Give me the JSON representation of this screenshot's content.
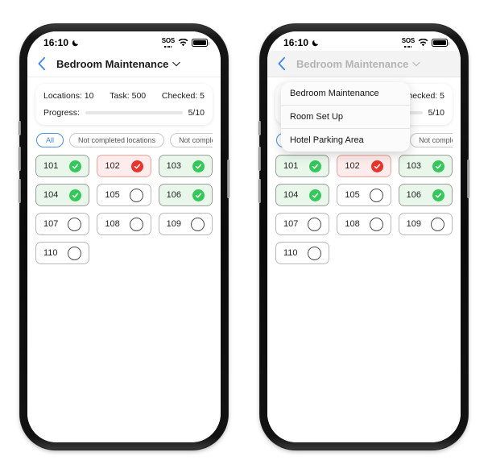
{
  "status_bar": {
    "time": "16:10",
    "moon_icon": "moon-icon",
    "sos_label": "SOS",
    "wifi_icon": "wifi-icon",
    "battery_icon": "battery-icon"
  },
  "nav": {
    "back_icon": "back-chevron-icon",
    "title": "Bedroom Maintenance",
    "caret_icon": "chevron-down-icon"
  },
  "summary": {
    "locations": "Locations: 10",
    "task": "Task: 500",
    "checked": "Checked: 5",
    "progress_label": "Progress:",
    "progress_value": "5/10",
    "progress_percent": 50,
    "progress_color": "#3b82f6"
  },
  "filters": [
    {
      "label": "All",
      "selected": true
    },
    {
      "label": "Not completed locations",
      "selected": false
    },
    {
      "label": "Not completed locations",
      "selected": false
    }
  ],
  "locations": [
    {
      "label": "101",
      "state": "done"
    },
    {
      "label": "102",
      "state": "issue"
    },
    {
      "label": "103",
      "state": "done"
    },
    {
      "label": "104",
      "state": "done"
    },
    {
      "label": "105",
      "state": "pending"
    },
    {
      "label": "106",
      "state": "done"
    },
    {
      "label": "107",
      "state": "pending"
    },
    {
      "label": "108",
      "state": "pending"
    },
    {
      "label": "109",
      "state": "pending"
    },
    {
      "label": "110",
      "state": "pending"
    }
  ],
  "dropdown": {
    "items": [
      {
        "label": "Bedroom Maintenance"
      },
      {
        "label": "Room Set Up"
      },
      {
        "label": "Hotel Parking Area"
      }
    ]
  },
  "colors": {
    "accent_blue": "#3b82f6",
    "success_green": "#34c759",
    "danger_red": "#e8342a",
    "card_done_bg": "#e8f7ea",
    "card_issue_bg": "#fdeceb"
  }
}
